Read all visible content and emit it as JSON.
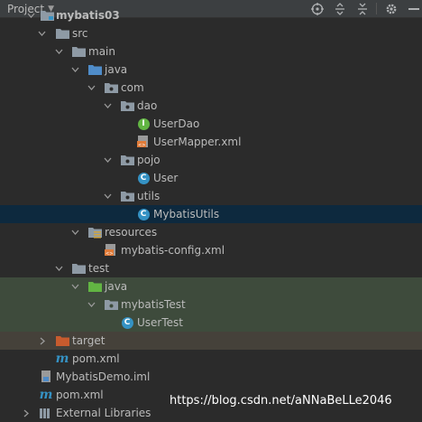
{
  "toolbar": {
    "title": "Project",
    "icons": [
      "globe-icon",
      "expand-all-icon",
      "collapse-all-icon",
      "settings-icon",
      "hide-icon"
    ]
  },
  "tree": {
    "root": "mybatis03",
    "src": "src",
    "main": "main",
    "main_java": "java",
    "com": "com",
    "dao": "dao",
    "user_dao": "UserDao",
    "user_mapper": "UserMapper.xml",
    "pojo": "pojo",
    "user": "User",
    "utils": "utils",
    "mybatis_utils": "MybatisUtils",
    "resources": "resources",
    "mybatis_config": "mybatis-config.xml",
    "test": "test",
    "test_java": "java",
    "mybatis_test": "mybatisTest",
    "user_test": "UserTest",
    "target": "target",
    "pom_inner": "pom.xml",
    "demo_iml": "MybatisDemo.iml",
    "pom_root": "pom.xml",
    "external_libraries": "External Libraries"
  },
  "colors": {
    "selected_row": "#0d293e",
    "test_rows": "#3e4b3c",
    "excluded_row": "#45413a",
    "folder": "#8e9aa5",
    "target_folder": "#c75b2e",
    "class_icon": "#3592c4",
    "interface_icon": "#62b543"
  },
  "watermark": "https://blog.csdn.net/aNNaBeLLe2046"
}
